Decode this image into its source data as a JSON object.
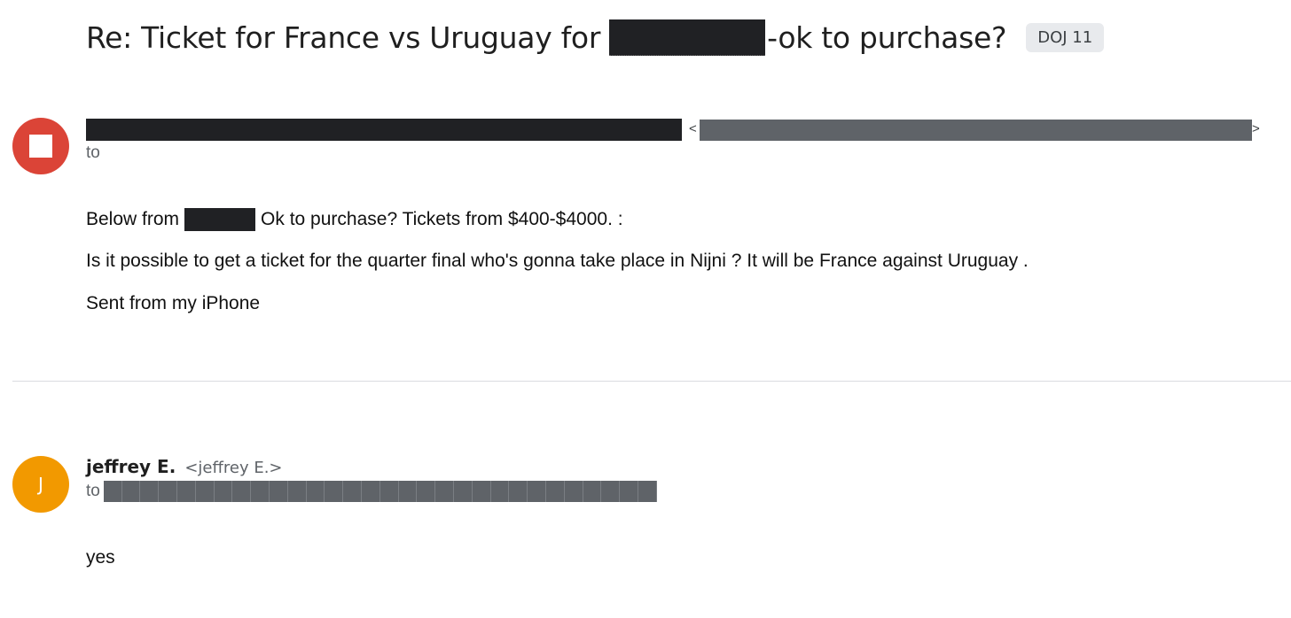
{
  "thread": {
    "subject_prefix": "Re: Ticket for France vs Uruguay for",
    "subject_suffix": "-ok to purchase?",
    "label": "DOJ 11"
  },
  "message1": {
    "lt": "<",
    "gt": ">",
    "to_label": "to",
    "body_line1_before": "Below from",
    "body_line1_after": "Ok to purchase? Tickets from $400-$4000. :",
    "body_line2": "Is it possible to get a ticket for the quarter final who's gonna take place in Nijni ? It will be France against Uruguay .",
    "body_line3": "Sent from my iPhone",
    "avatar_color": "#db4437"
  },
  "message2": {
    "avatar_initial": "J",
    "avatar_color": "#f29900",
    "sender_name": "jeffrey E.",
    "sender_email": "<jeffrey E.>",
    "to_label": "to",
    "body": "yes"
  }
}
